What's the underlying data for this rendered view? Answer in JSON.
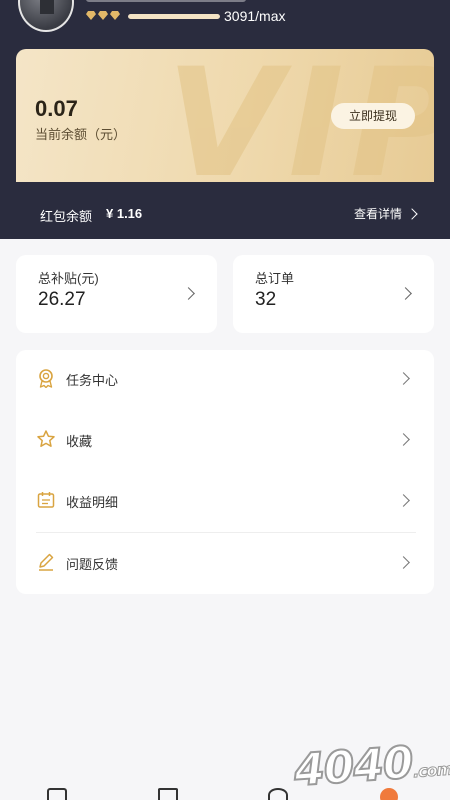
{
  "profile": {
    "xp_text": "3091/max",
    "xp_fraction": 1.0,
    "gem_count": 3
  },
  "vip": {
    "watermark": "VIP",
    "balance": "0.07",
    "balance_label": "当前余额（元）",
    "withdraw_label": "立即提现"
  },
  "red_packet": {
    "label": "红包余额",
    "value": "¥ 1.16",
    "detail_label": "查看详情"
  },
  "stats": [
    {
      "label": "总补贴(元)",
      "value": "26.27"
    },
    {
      "label": "总订单",
      "value": "32"
    }
  ],
  "menu": [
    {
      "label": "任务中心",
      "icon": "badge-icon"
    },
    {
      "label": "收藏",
      "icon": "star-icon"
    },
    {
      "label": "收益明细",
      "icon": "calendar-icon"
    },
    {
      "label": "问题反馈",
      "icon": "pencil-icon"
    }
  ],
  "colors": {
    "header_bg": "#2a2c3e",
    "gold": "#d9a441",
    "page_bg": "#f6f6f8"
  },
  "watermark_logo": {
    "main": "4040",
    "suffix": ".com"
  }
}
